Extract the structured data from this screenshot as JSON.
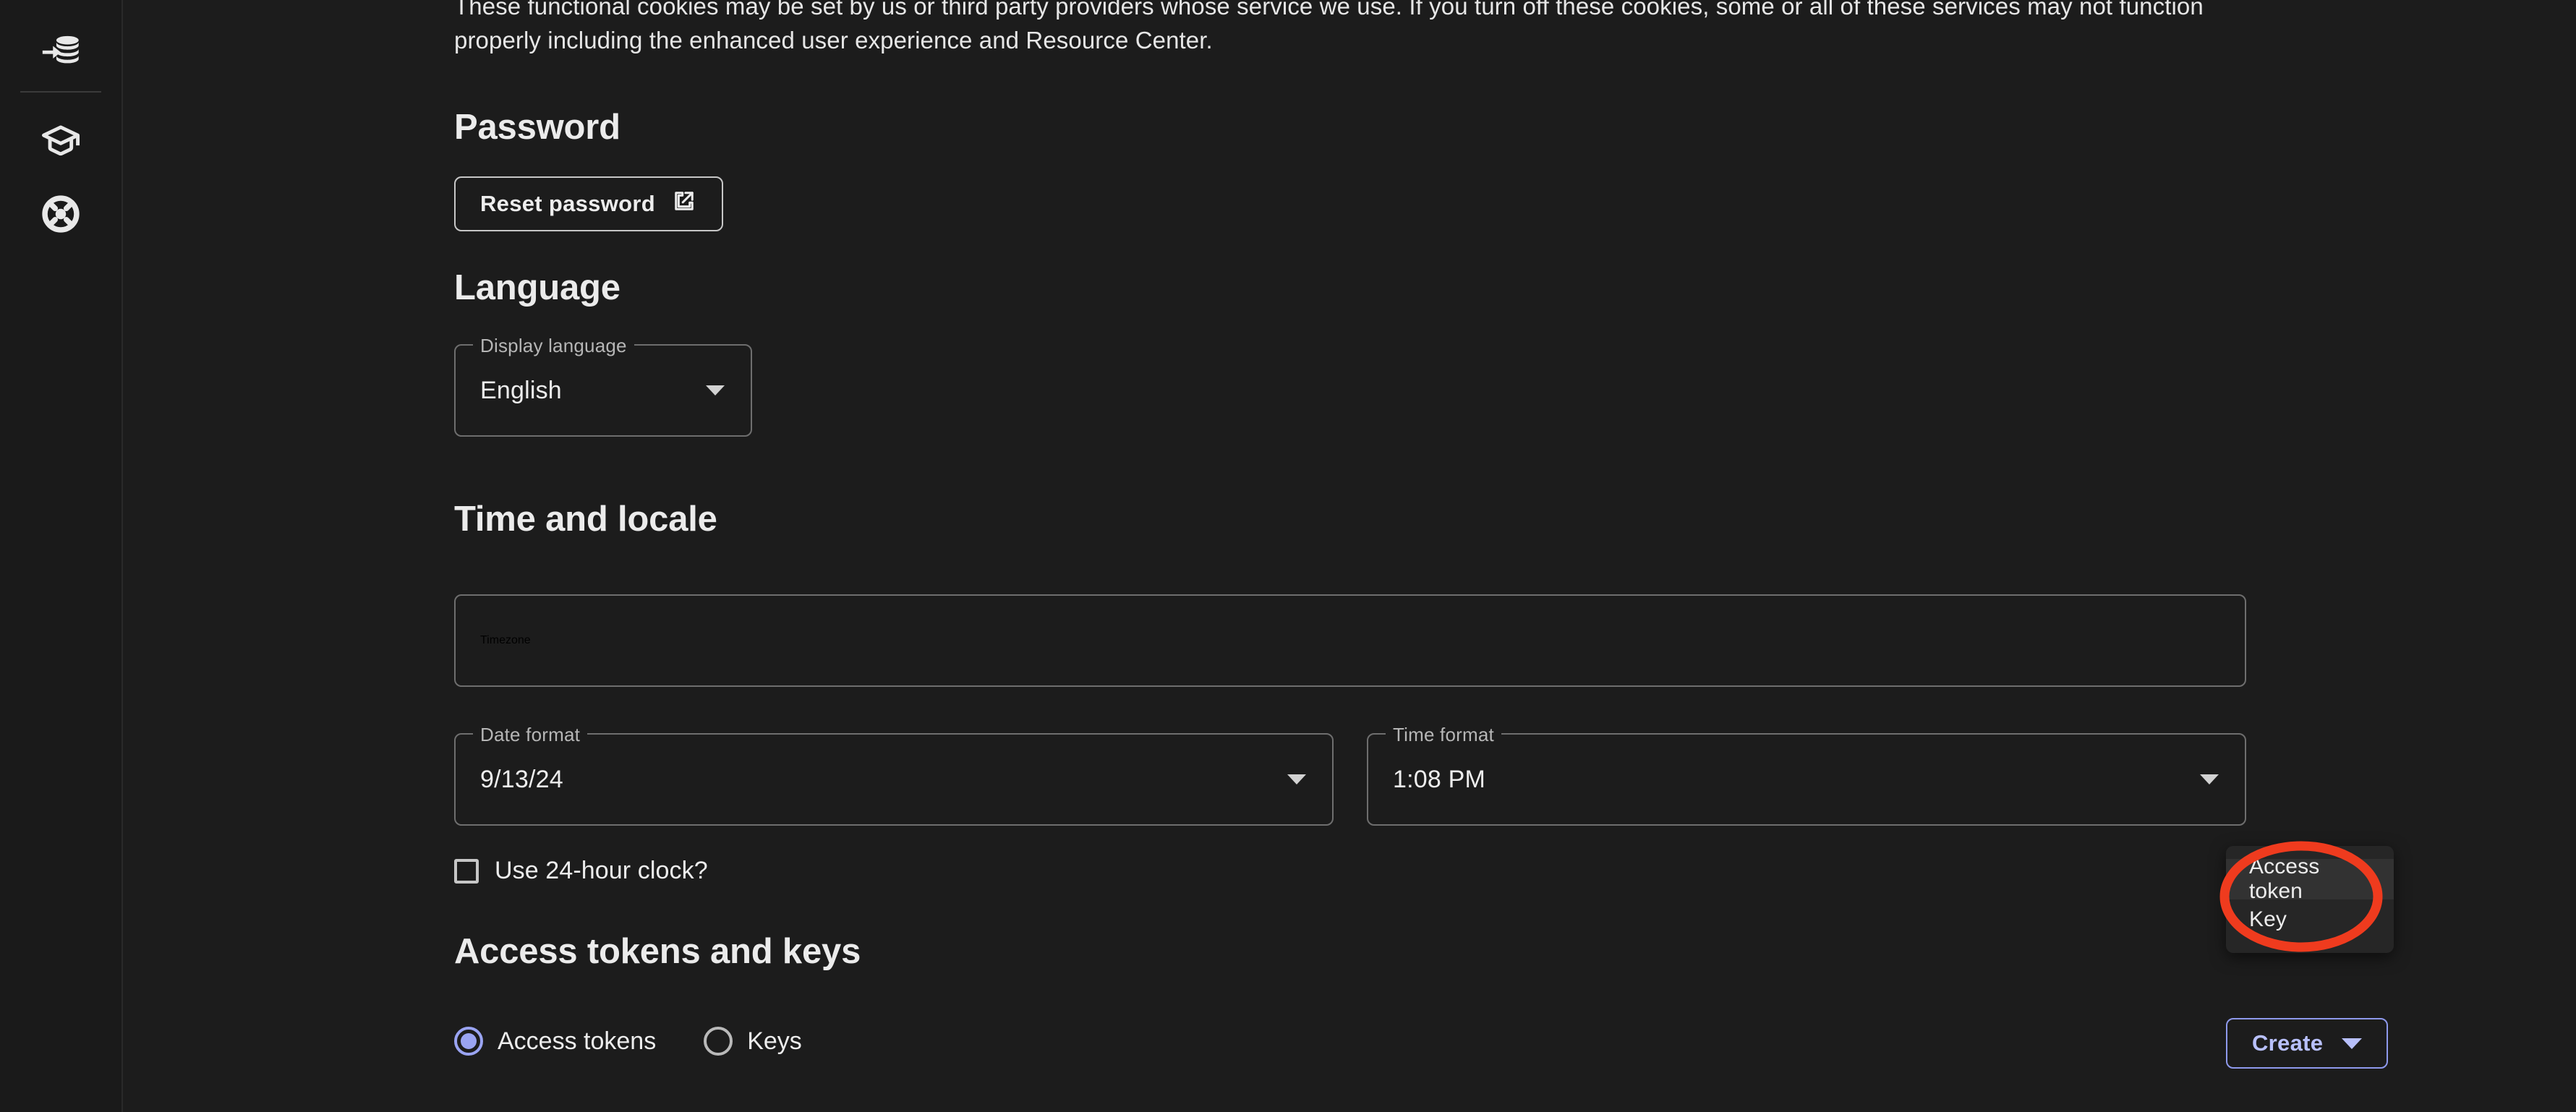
{
  "sidebar": {
    "items": [
      {
        "name": "data-import-icon",
        "label": "Data"
      },
      {
        "name": "learning-icon",
        "label": "Learning"
      },
      {
        "name": "support-icon",
        "label": "Support"
      }
    ]
  },
  "cookie_notice": {
    "text": "We use cookies to provide guided tours, helpful hints, and customized content. This helps you quickly onboard and maximize your VantageCloud Lake experience. These functional cookies may be set by us or third party providers whose service we use. If you turn off these cookies, some or all of these services may not function properly including the enhanced user experience and Resource Center."
  },
  "password": {
    "heading": "Password",
    "reset_button": "Reset password",
    "reset_icon": "external-link-icon"
  },
  "language": {
    "heading": "Language",
    "display_language": {
      "label": "Display language",
      "value": "English"
    }
  },
  "time_locale": {
    "heading": "Time and locale",
    "timezone": {
      "placeholder": "Timezone",
      "value": ""
    },
    "date_format": {
      "label": "Date format",
      "value": "9/13/24"
    },
    "time_format": {
      "label": "Time format",
      "value": "1:08 PM"
    },
    "use_24h": {
      "label": "Use 24-hour clock?",
      "checked": false
    }
  },
  "tokens": {
    "heading": "Access tokens and keys",
    "radios": [
      {
        "label": "Access tokens",
        "selected": true
      },
      {
        "label": "Keys",
        "selected": false
      }
    ],
    "create_button": "Create",
    "create_caret_icon": "chevron-down-icon",
    "menu": [
      {
        "label": "Access token",
        "hovered": true
      },
      {
        "label": "Key",
        "hovered": false
      }
    ]
  },
  "colors": {
    "background": "#1c1c1c",
    "sidebar": "#1a1a1a",
    "accent": "#b8c0fb",
    "radio_accent": "#9aa4f2",
    "annotation": "#ef3b1e",
    "menu_surface": "#262626"
  }
}
